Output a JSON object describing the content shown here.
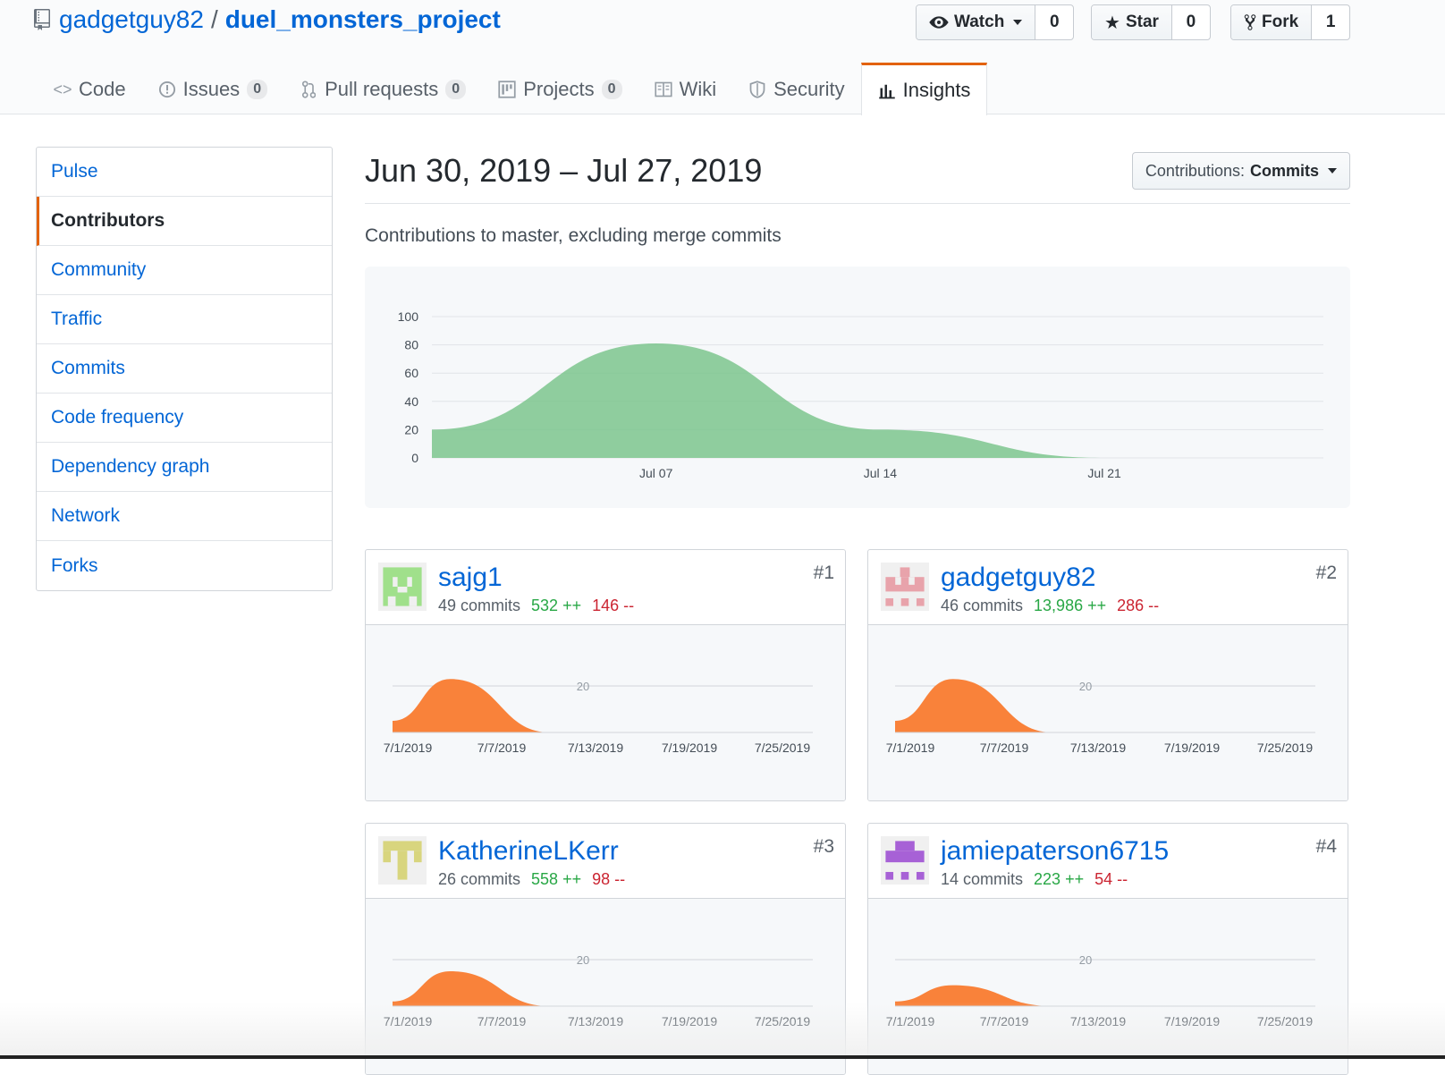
{
  "repo": {
    "owner": "gadgetguy82",
    "separator": "/",
    "name": "duel_monsters_project"
  },
  "actions": {
    "watch": {
      "label": "Watch",
      "count": "0"
    },
    "star": {
      "label": "Star",
      "count": "0"
    },
    "fork": {
      "label": "Fork",
      "count": "1"
    }
  },
  "tabs": [
    {
      "label": "Code",
      "icon": "code-icon"
    },
    {
      "label": "Issues",
      "count": "0",
      "icon": "issue-icon"
    },
    {
      "label": "Pull requests",
      "count": "0",
      "icon": "pull-request-icon"
    },
    {
      "label": "Projects",
      "count": "0",
      "icon": "project-icon"
    },
    {
      "label": "Wiki",
      "icon": "book-icon"
    },
    {
      "label": "Security",
      "icon": "shield-icon"
    },
    {
      "label": "Insights",
      "icon": "graph-icon",
      "selected": true
    }
  ],
  "sidebar": {
    "items": [
      "Pulse",
      "Contributors",
      "Community",
      "Traffic",
      "Commits",
      "Code frequency",
      "Dependency graph",
      "Network",
      "Forks"
    ],
    "selected": "Contributors"
  },
  "main": {
    "range": "Jun 30, 2019 – Jul 27, 2019",
    "contrib_label": "Contributions:",
    "contrib_value": "Commits",
    "subtitle": "Contributions to master, excluding merge commits"
  },
  "chart_data": [
    {
      "type": "area",
      "y_ticks": [
        0,
        20,
        40,
        60,
        80,
        100
      ],
      "ylim": [
        0,
        100
      ],
      "x_ticks": [
        "Jul 07",
        "Jul 14",
        "Jul 21"
      ],
      "x": [
        "Jun 30",
        "Jul 07",
        "Jul 14",
        "Jul 21",
        "Jul 27"
      ],
      "values": [
        20,
        81,
        20,
        0,
        0
      ],
      "color": "#7dc58d"
    },
    {
      "type": "area",
      "y_ticks": [
        20
      ],
      "x_ticks": [
        "7/1/2019",
        "7/7/2019",
        "7/13/2019",
        "7/19/2019",
        "7/25/2019"
      ],
      "values": [
        5,
        23,
        0,
        0,
        0
      ],
      "color": "#f9823a"
    },
    {
      "type": "area",
      "y_ticks": [
        20
      ],
      "x_ticks": [
        "7/1/2019",
        "7/7/2019",
        "7/13/2019",
        "7/19/2019",
        "7/25/2019"
      ],
      "values": [
        5,
        23,
        0,
        0,
        0
      ],
      "color": "#f9823a"
    },
    {
      "type": "area",
      "y_ticks": [
        20
      ],
      "x_ticks": [
        "7/1/2019",
        "7/7/2019",
        "7/13/2019",
        "7/19/2019",
        "7/25/2019"
      ],
      "values": [
        2,
        15,
        0,
        0,
        0
      ],
      "color": "#f9823a"
    },
    {
      "type": "area",
      "y_ticks": [
        20
      ],
      "x_ticks": [
        "7/1/2019",
        "7/7/2019",
        "7/13/2019",
        "7/19/2019",
        "7/25/2019"
      ],
      "values": [
        2,
        9,
        0,
        0,
        0
      ],
      "color": "#f9823a"
    }
  ],
  "contributors": [
    {
      "rank": "#1",
      "user": "sajg1",
      "commits": "49 commits",
      "additions": "532 ++",
      "deletions": "146 --",
      "avatar_color": "#a0e08b"
    },
    {
      "rank": "#2",
      "user": "gadgetguy82",
      "commits": "46 commits",
      "additions": "13,986 ++",
      "deletions": "286 --",
      "avatar_color": "#e8a3ab"
    },
    {
      "rank": "#3",
      "user": "KatherineLKerr",
      "commits": "26 commits",
      "additions": "558 ++",
      "deletions": "98 --",
      "avatar_color": "#d8d57e"
    },
    {
      "rank": "#4",
      "user": "jamiepaterson6715",
      "commits": "14 commits",
      "additions": "223 ++",
      "deletions": "54 --",
      "avatar_color": "#a761d6"
    }
  ]
}
